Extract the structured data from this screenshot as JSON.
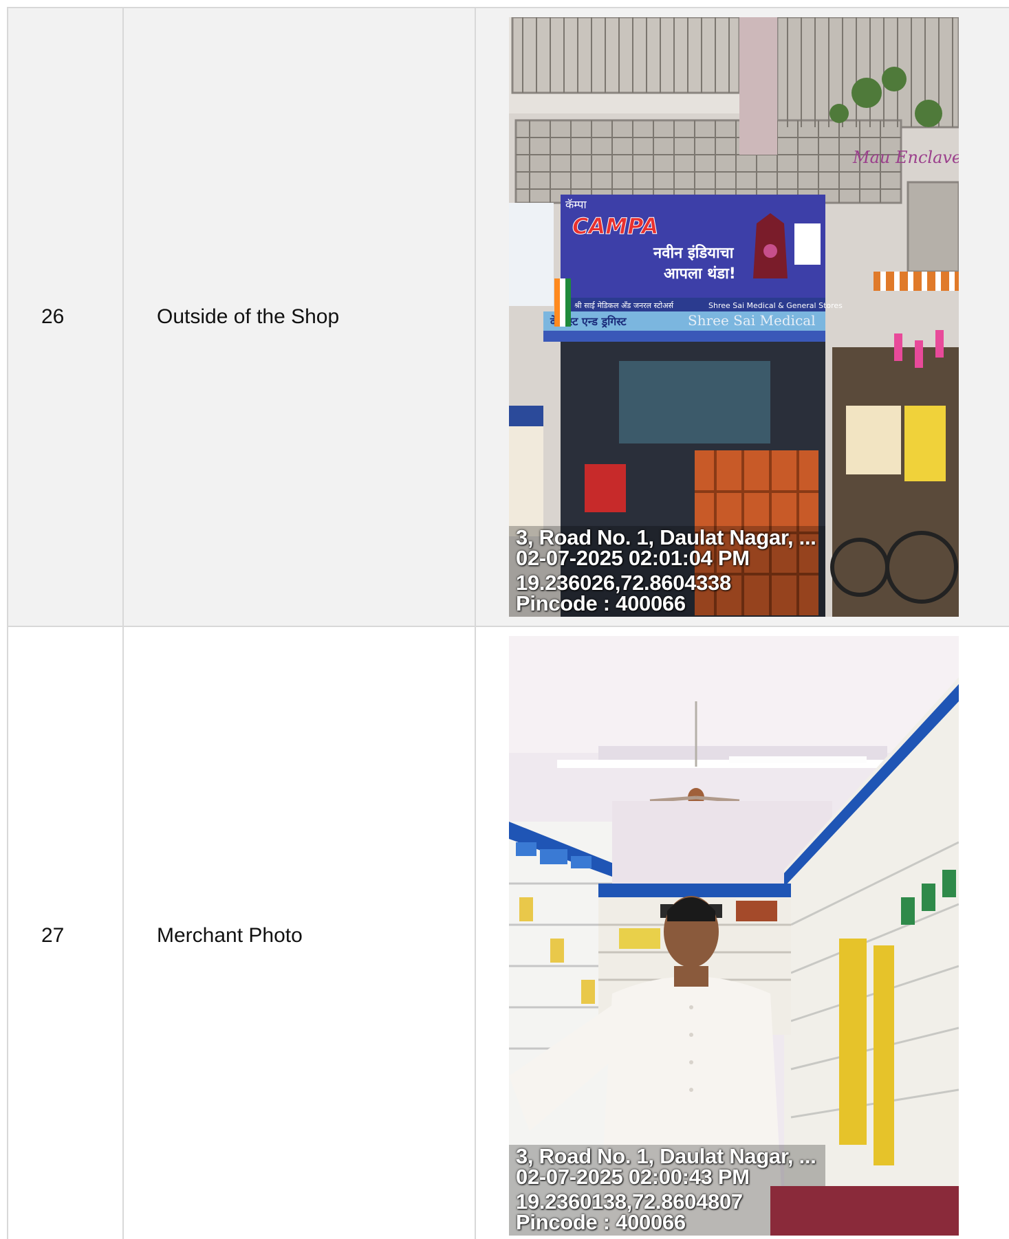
{
  "rows": [
    {
      "number": "26",
      "label": "Outside of the Shop",
      "photo": {
        "subject": "storefront",
        "sign_brand": "CAMPA",
        "sign_top": "कॅम्पा",
        "sign_tagline_1": "नवीन इंडियाचा",
        "sign_tagline_2": "आपला थंडा!",
        "shop_name_marathi": "श्री साई मेडिकल अँड जनरल स्टोअर्स",
        "shop_name_english": "Shree Sai Medical & General Stores",
        "shop_strip": "केमिस्ट एन्ड ड्रगिस्ट",
        "shop_strip_right": "Shree Sai Medical",
        "building_sign": "Mau Enclave",
        "stamp": {
          "address": "3, Road No. 1, Daulat Nagar, ...",
          "datetime": "02-07-2025 02:01:04 PM",
          "coords": "19.236026,72.8604338",
          "pincode": "Pincode : 400066"
        }
      }
    },
    {
      "number": "27",
      "label": "Merchant Photo",
      "photo": {
        "subject": "merchant-inside-pharmacy",
        "stamp": {
          "address": "3, Road No. 1, Daulat Nagar, ...",
          "datetime": "02-07-2025 02:00:43 PM",
          "coords": "19.2360138,72.8604807",
          "pincode": "Pincode : 400066"
        }
      }
    }
  ],
  "colors": {
    "row_shade": "#f2f2f2",
    "border": "#d8d8d8",
    "sign_blue": "#3d3fa8",
    "shelf_blue": "#1f55b5"
  }
}
